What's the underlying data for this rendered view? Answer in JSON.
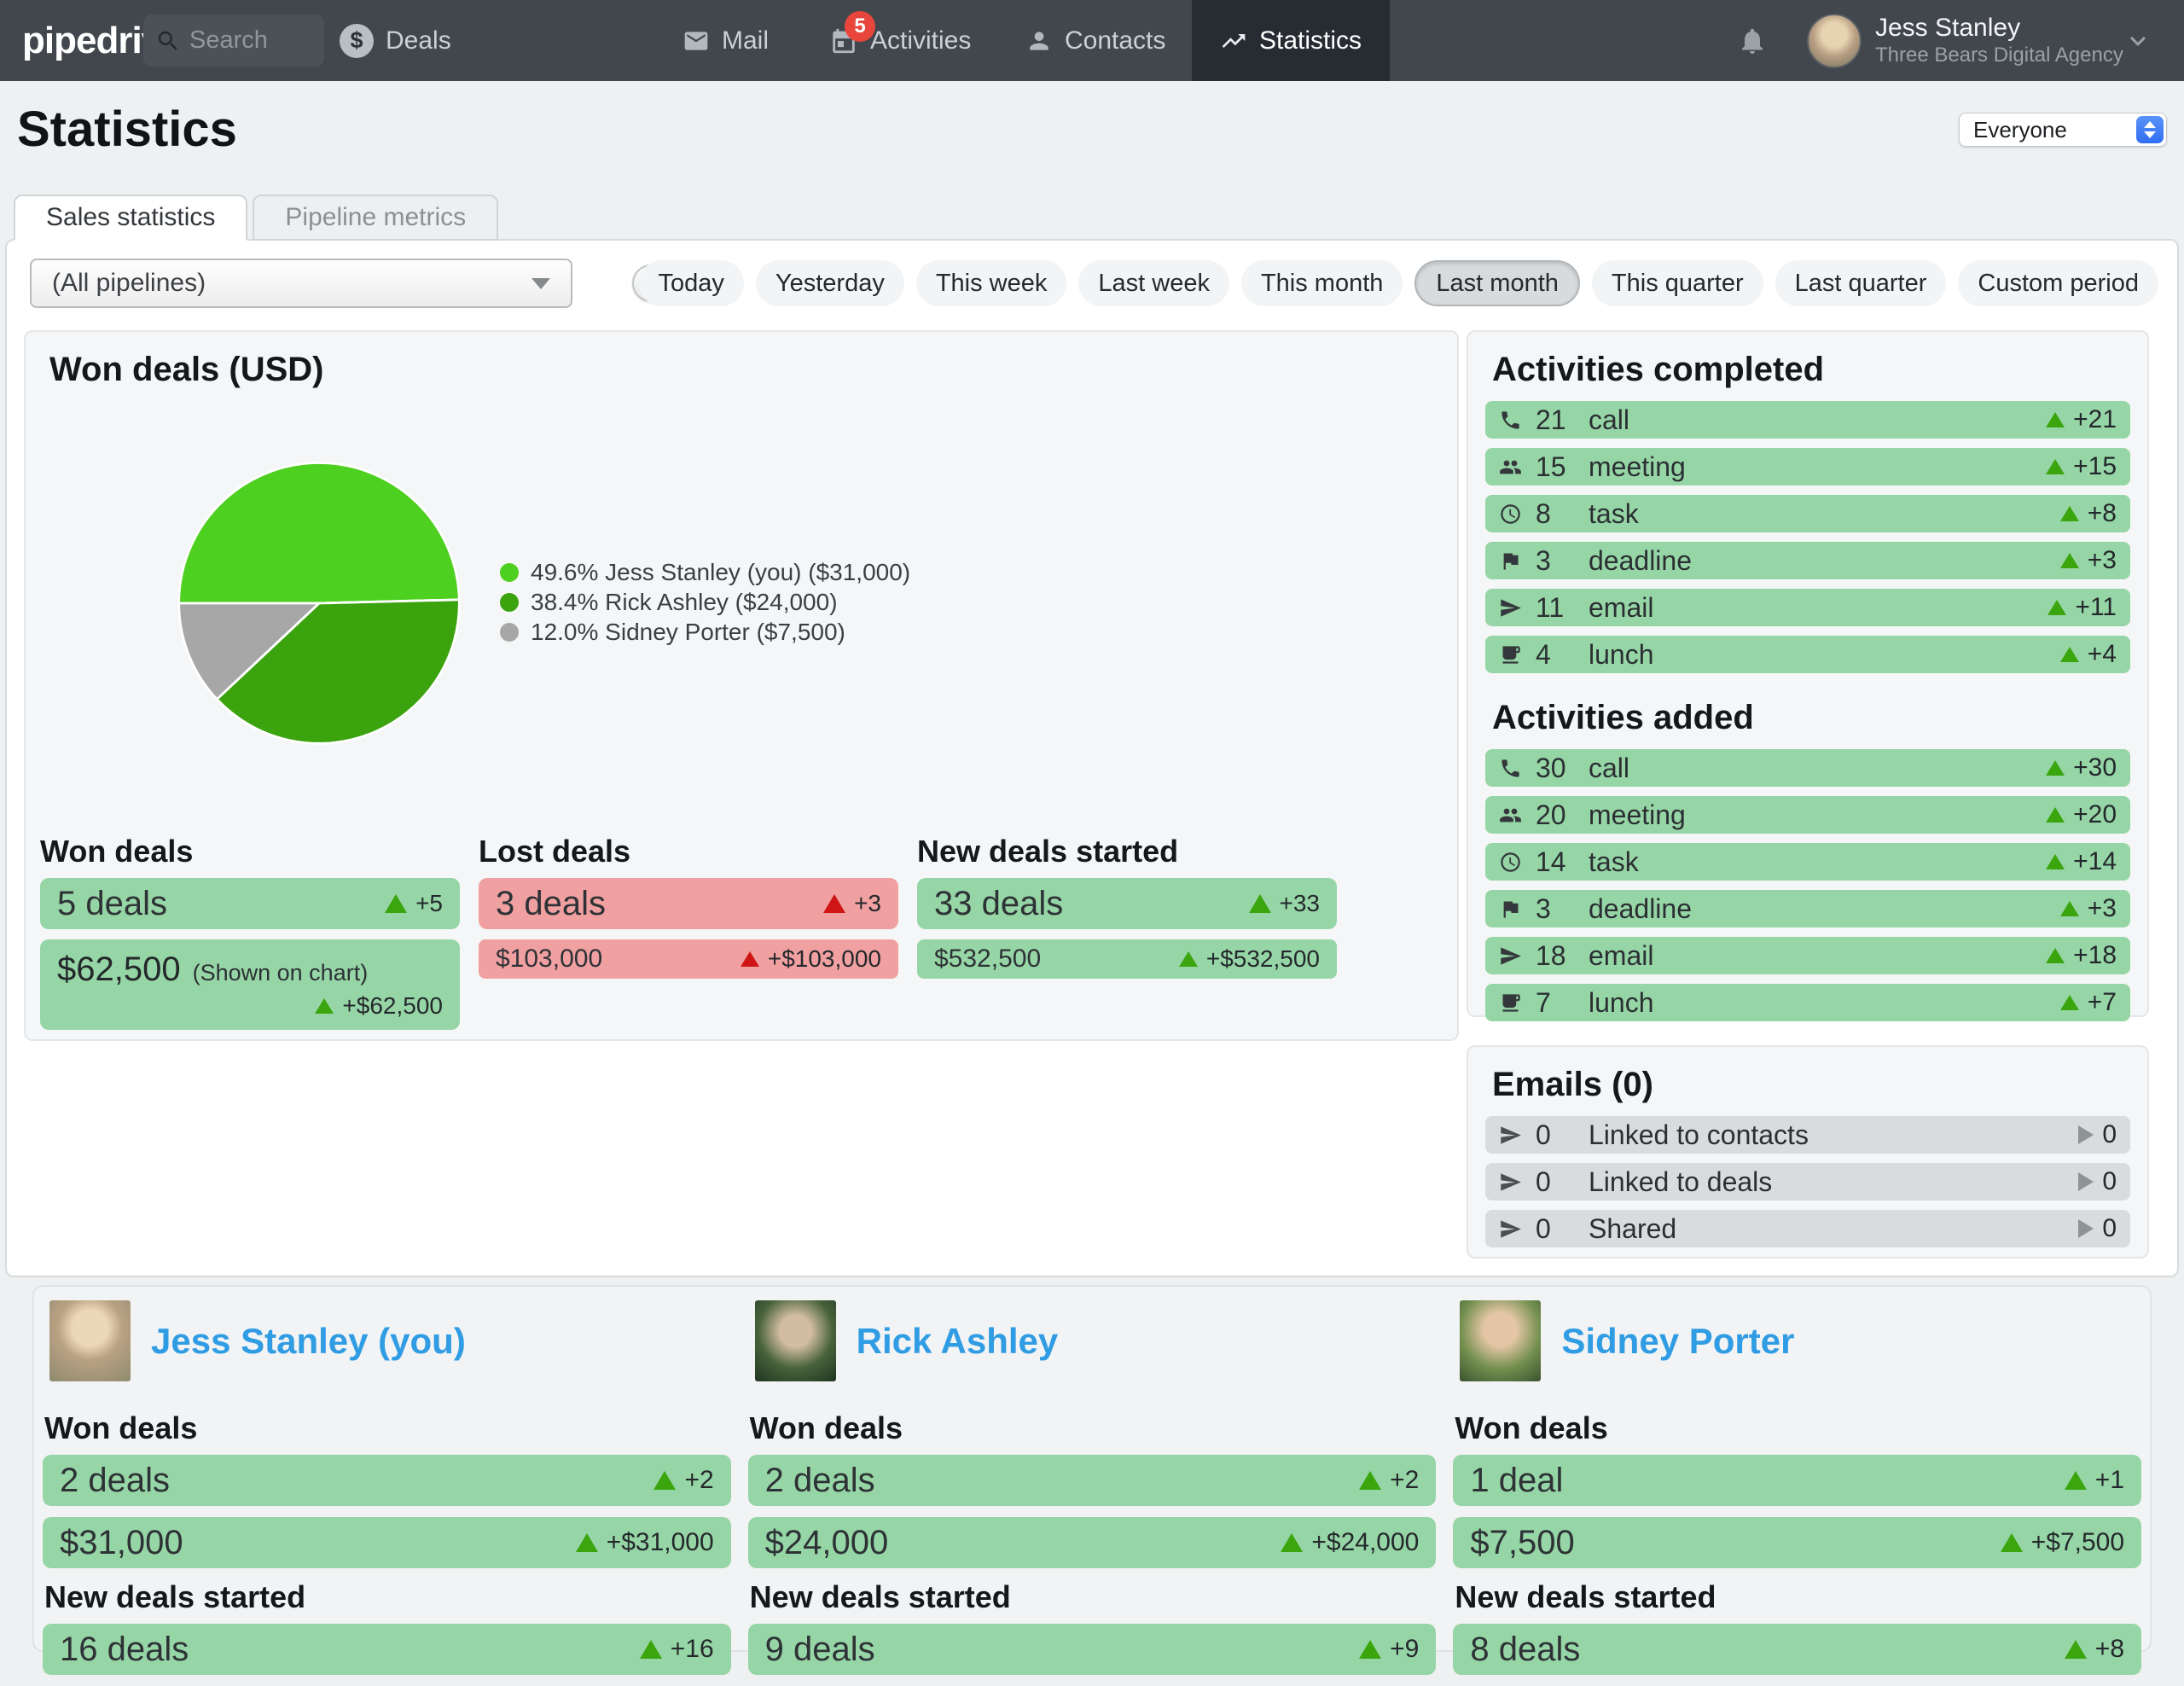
{
  "chart_data": {
    "type": "pie",
    "title": "Won deals (USD)",
    "labels": [
      "Jess Stanley (you)",
      "Rick Ashley",
      "Sidney Porter"
    ],
    "values": [
      31000,
      24000,
      7500
    ],
    "percentages": [
      49.6,
      38.4,
      12.0
    ],
    "colors": [
      "#4dd01f",
      "#3aa30d",
      "#a7a7a7"
    ],
    "legend_position": "right",
    "legend_entries": [
      "49.6% Jess Stanley (you) ($31,000)",
      "38.4% Rick Ashley ($24,000)",
      "12.0% Sidney Porter ($7,500)"
    ]
  },
  "nav": {
    "logo": "pipedrive",
    "search_placeholder": "Search",
    "deals": "Deals",
    "mail": "Mail",
    "activities": "Activities",
    "activities_badge": "5",
    "contacts": "Contacts",
    "statistics": "Statistics",
    "user_name": "Jess Stanley",
    "user_company": "Three Bears Digital Agency"
  },
  "header": {
    "title": "Statistics",
    "scope_select": "Everyone"
  },
  "tabs": {
    "sales": "Sales statistics",
    "pipeline": "Pipeline metrics"
  },
  "filters": {
    "pipeline_select": "(All pipelines)",
    "help": "?",
    "periods": [
      "Today",
      "Yesterday",
      "This week",
      "Last week",
      "This month",
      "Last month",
      "This quarter",
      "Last quarter",
      "Custom period"
    ],
    "selected": "Last month"
  },
  "won_panel": {
    "title": "Won deals (USD)",
    "stats": [
      {
        "label": "Won deals",
        "count": "5 deals",
        "count_delta": "+5",
        "amount": "$62,500",
        "amount_note": "(Shown on chart)",
        "amount_delta": "+$62,500"
      },
      {
        "label": "Lost deals",
        "count": "3 deals",
        "count_delta": "+3",
        "amount": "$103,000",
        "amount_delta": "+$103,000"
      },
      {
        "label": "New deals started",
        "count": "33 deals",
        "count_delta": "+33",
        "amount": "$532,500",
        "amount_delta": "+$532,500"
      }
    ]
  },
  "activities_completed": {
    "title": "Activities completed",
    "rows": [
      {
        "icon": "phone",
        "count": "21",
        "label": "call",
        "delta": "+21"
      },
      {
        "icon": "people",
        "count": "15",
        "label": "meeting",
        "delta": "+15"
      },
      {
        "icon": "clock",
        "count": "8",
        "label": "task",
        "delta": "+8"
      },
      {
        "icon": "flag",
        "count": "3",
        "label": "deadline",
        "delta": "+3"
      },
      {
        "icon": "paper-plane",
        "count": "11",
        "label": "email",
        "delta": "+11"
      },
      {
        "icon": "cup",
        "count": "4",
        "label": "lunch",
        "delta": "+4"
      }
    ]
  },
  "activities_added": {
    "title": "Activities added",
    "rows": [
      {
        "icon": "phone",
        "count": "30",
        "label": "call",
        "delta": "+30"
      },
      {
        "icon": "people",
        "count": "20",
        "label": "meeting",
        "delta": "+20"
      },
      {
        "icon": "clock",
        "count": "14",
        "label": "task",
        "delta": "+14"
      },
      {
        "icon": "flag",
        "count": "3",
        "label": "deadline",
        "delta": "+3"
      },
      {
        "icon": "paper-plane",
        "count": "18",
        "label": "email",
        "delta": "+18"
      },
      {
        "icon": "cup",
        "count": "7",
        "label": "lunch",
        "delta": "+7"
      }
    ]
  },
  "emails_panel": {
    "title": "Emails (0)",
    "rows": [
      {
        "count": "0",
        "label": "Linked to contacts",
        "value": "0"
      },
      {
        "count": "0",
        "label": "Linked to deals",
        "value": "0"
      },
      {
        "count": "0",
        "label": "Shared",
        "value": "0"
      }
    ]
  },
  "team": [
    {
      "name": "Jess Stanley (you)",
      "won_label": "Won deals",
      "won_count": "2 deals",
      "won_count_delta": "+2",
      "won_amount": "$31,000",
      "won_amount_delta": "+$31,000",
      "new_label": "New deals started",
      "new_count": "16 deals",
      "new_count_delta": "+16"
    },
    {
      "name": "Rick Ashley",
      "won_label": "Won deals",
      "won_count": "2 deals",
      "won_count_delta": "+2",
      "won_amount": "$24,000",
      "won_amount_delta": "+$24,000",
      "new_label": "New deals started",
      "new_count": "9 deals",
      "new_count_delta": "+9"
    },
    {
      "name": "Sidney Porter",
      "won_label": "Won deals",
      "won_count": "1 deal",
      "won_count_delta": "+1",
      "won_amount": "$7,500",
      "won_amount_delta": "+$7,500",
      "new_label": "New deals started",
      "new_count": "8 deals",
      "new_count_delta": "+8"
    }
  ]
}
